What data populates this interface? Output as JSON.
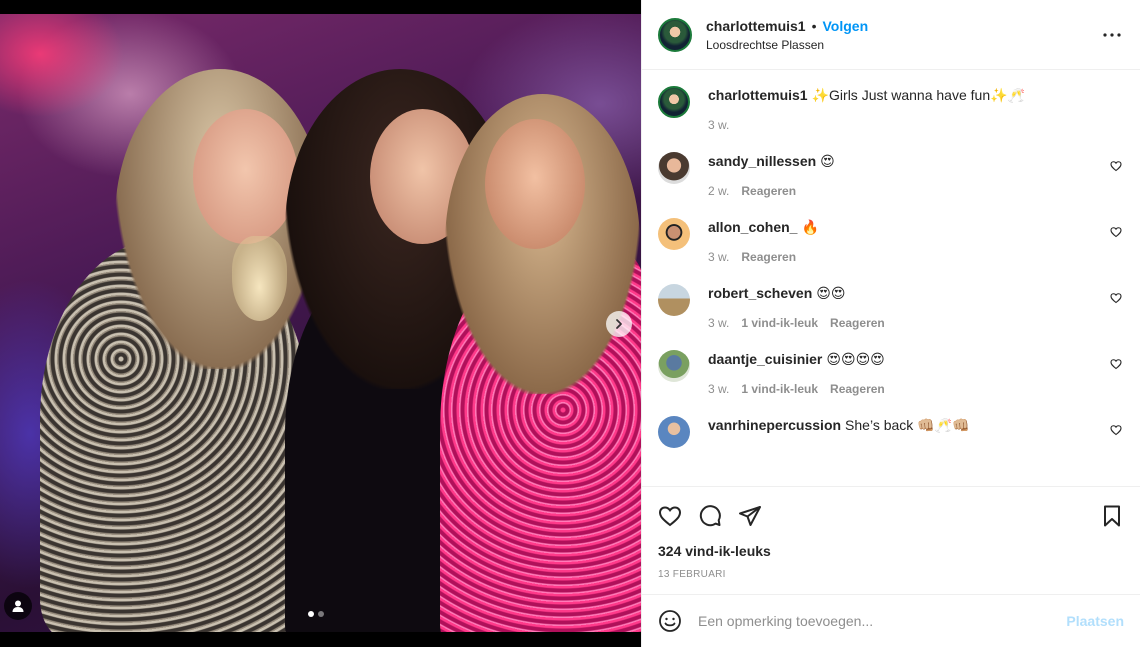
{
  "post": {
    "username": "charlottemuis1",
    "separator": "•",
    "follow_label": "Volgen",
    "location": "Loosdrechtse Plassen",
    "more_icon": "more-horizontal-icon"
  },
  "photo": {
    "carousel_index": 1,
    "carousel_total": 2,
    "next_icon": "chevron-right-icon",
    "tag_icon": "user-tag-icon"
  },
  "caption": {
    "username": "charlottemuis1",
    "text": "✨Girls Just wanna have fun✨🥂",
    "time": "3 w."
  },
  "comments": [
    {
      "username": "sandy_nillessen",
      "text": "😍",
      "time": "2 w.",
      "likes": "",
      "reply": "Reageren"
    },
    {
      "username": "allon_cohen_",
      "text": "🔥",
      "time": "3 w.",
      "likes": "",
      "reply": "Reageren"
    },
    {
      "username": "robert_scheven",
      "text": "😍😍",
      "time": "3 w.",
      "likes": "1 vind-ik-leuk",
      "reply": "Reageren"
    },
    {
      "username": "daantje_cuisinier",
      "text": "😍😍😍😍",
      "time": "3 w.",
      "likes": "1 vind-ik-leuk",
      "reply": "Reageren"
    },
    {
      "username": "vanrhinepercussion",
      "text": "She’s back 👊🏼🥂👊🏼",
      "time": "",
      "likes": "",
      "reply": ""
    }
  ],
  "actions": {
    "like_icon": "heart-icon",
    "comment_icon": "comment-icon",
    "share_icon": "share-icon",
    "save_icon": "bookmark-icon",
    "likes_text": "324 vind-ik-leuks",
    "date": "13 FEBRUARI"
  },
  "add_comment": {
    "emoji_icon": "emoji-icon",
    "placeholder": "Een opmerking toevoegen...",
    "post_label": "Plaatsen"
  },
  "colors": {
    "accent": "#0095f6",
    "post_disabled": "#b2dffc",
    "muted": "#8e8e8e"
  }
}
